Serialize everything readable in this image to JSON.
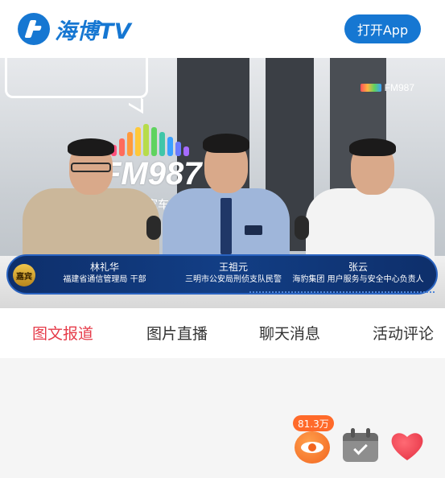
{
  "header": {
    "logo_text": "海博TV",
    "open_app_label": "打开App"
  },
  "video": {
    "station_logo": "FM987",
    "station_sub": "私家车",
    "watermark": "FM987",
    "badge_icon": "嘉宾",
    "guests": [
      {
        "name": "林礼华",
        "title": "福建省通信管理局 干部"
      },
      {
        "name": "王祖元",
        "title": "三明市公安局刑侦支队民警"
      },
      {
        "name": "张云",
        "title": "海豹集团 用户服务与安全中心负责人"
      }
    ]
  },
  "tabs": [
    {
      "label": "图文报道",
      "active": true
    },
    {
      "label": "图片直播",
      "active": false
    },
    {
      "label": "聊天消息",
      "active": false
    },
    {
      "label": "活动评论",
      "active": false
    }
  ],
  "floating": {
    "views_count": "81.3万",
    "icons": [
      "eye-icon",
      "calendar-check-icon",
      "heart-icon"
    ]
  },
  "colors": {
    "brand_blue": "#1677d2",
    "active_tab": "#e63c4a",
    "views_orange": "#f2641f",
    "heart_red": "#e8394a"
  }
}
